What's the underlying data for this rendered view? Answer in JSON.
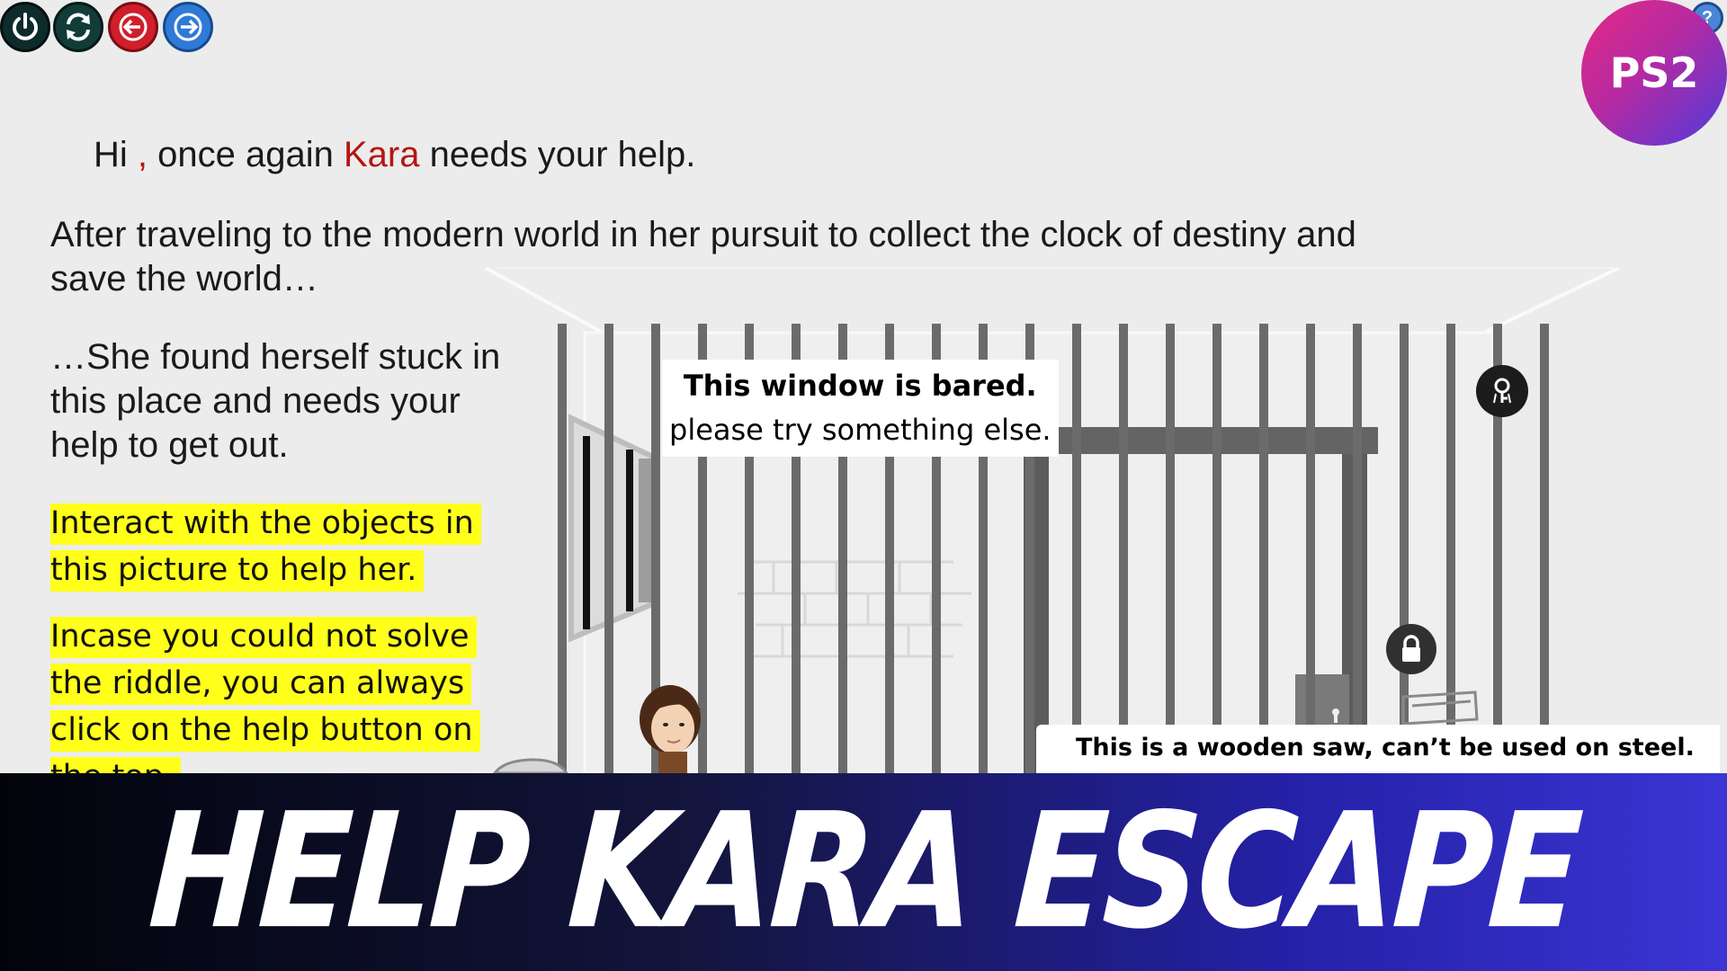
{
  "toolbar": {
    "power_icon": "power-icon",
    "reload_icon": "reload-icon",
    "back_icon": "arrow-left-icon",
    "forward_icon": "arrow-right-icon",
    "help_icon": "question-icon"
  },
  "badge": {
    "label": "PS2",
    "gradient": [
      "#e52a83",
      "#4d3bdc"
    ]
  },
  "story": {
    "greeting_hi": "Hi",
    "greeting_comma": ",",
    "greeting_mid": " once again ",
    "greeting_name": "Kara",
    "greeting_end": " needs your help.",
    "para1_line1": "After traveling to the modern world in her pursuit to collect the clock of destiny and",
    "para1_line2": "save the world…",
    "para2_line1": "…She found herself stuck in",
    "para2_line2": "this place and needs your",
    "para2_line3": "help to get out.",
    "hint1_line1": "Interact with the objects in",
    "hint1_line2": "this picture to help her.",
    "hint2_line1": "Incase you could not solve",
    "hint2_line2": "the riddle, you can always",
    "hint2_line3": "click on the help button on",
    "hint2_line4": "the top."
  },
  "scene": {
    "window_msg_line1": "This window is bared.",
    "window_msg_line2": "please try something else.",
    "saw_msg": "This is a wooden saw, can’t be used on steel.",
    "lock_icon": "padlock-icon",
    "key_icon": "key-hint-icon"
  },
  "banner": {
    "title": "HELP KARA ESCAPE"
  },
  "colors": {
    "background": "#ececec",
    "accent_red": "#b51414",
    "highlight": "#ffff1a",
    "bars": "#6b6b6b"
  }
}
